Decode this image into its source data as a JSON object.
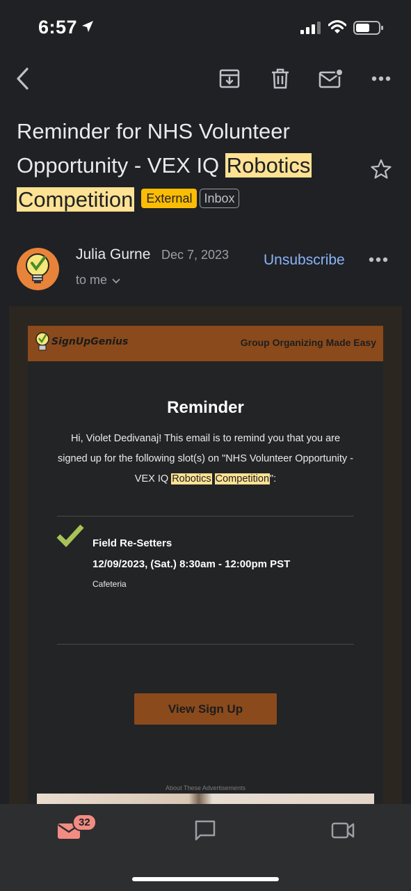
{
  "status": {
    "time": "6:57"
  },
  "toolbar": {
    "back_icon": "chevron-left-icon",
    "archive_icon": "archive-icon",
    "delete_icon": "trash-icon",
    "mark_unread_icon": "mail-unread-icon",
    "more_icon": "more-horizontal-icon"
  },
  "email": {
    "subject_part1": "Reminder for NHS Volunteer Opportunity - VEX IQ ",
    "subject_highlight1": "Robotics",
    "subject_highlight2": "Competition",
    "label_external": "External",
    "label_inbox": "Inbox",
    "sender_name": "Julia Gurne",
    "date": "Dec 7, 2023",
    "recipient": "to me",
    "unsubscribe": "Unsubscribe"
  },
  "body": {
    "brand_name": "SignUpGenius",
    "tagline": "Group Organizing Made Easy",
    "title": "Reminder",
    "message_part1": "Hi, Violet Dedivanaj! This email is to remind you that you are signed up for the following slot(s) on \"NHS Volunteer Opportunity - VEX IQ ",
    "message_highlight1": "Robotics",
    "message_highlight2": "Competition",
    "message_end": "\":",
    "slot_title": "Field Re-Setters",
    "slot_time": "12/09/2023, (Sat.) 8:30am - 12:00pm PST",
    "slot_location": "Cafeteria",
    "button_label": "View Sign Up",
    "ads_label": "About These Advertisements"
  },
  "nav": {
    "mail_badge": "32",
    "items": [
      "mail-icon",
      "chat-icon",
      "video-icon"
    ]
  },
  "colors": {
    "background": "#202124",
    "brand_brown": "#8a4a1c",
    "highlight": "#fde293",
    "external_label": "#fbbc04",
    "link_blue": "#8ab4f8",
    "badge": "#f28b82"
  }
}
